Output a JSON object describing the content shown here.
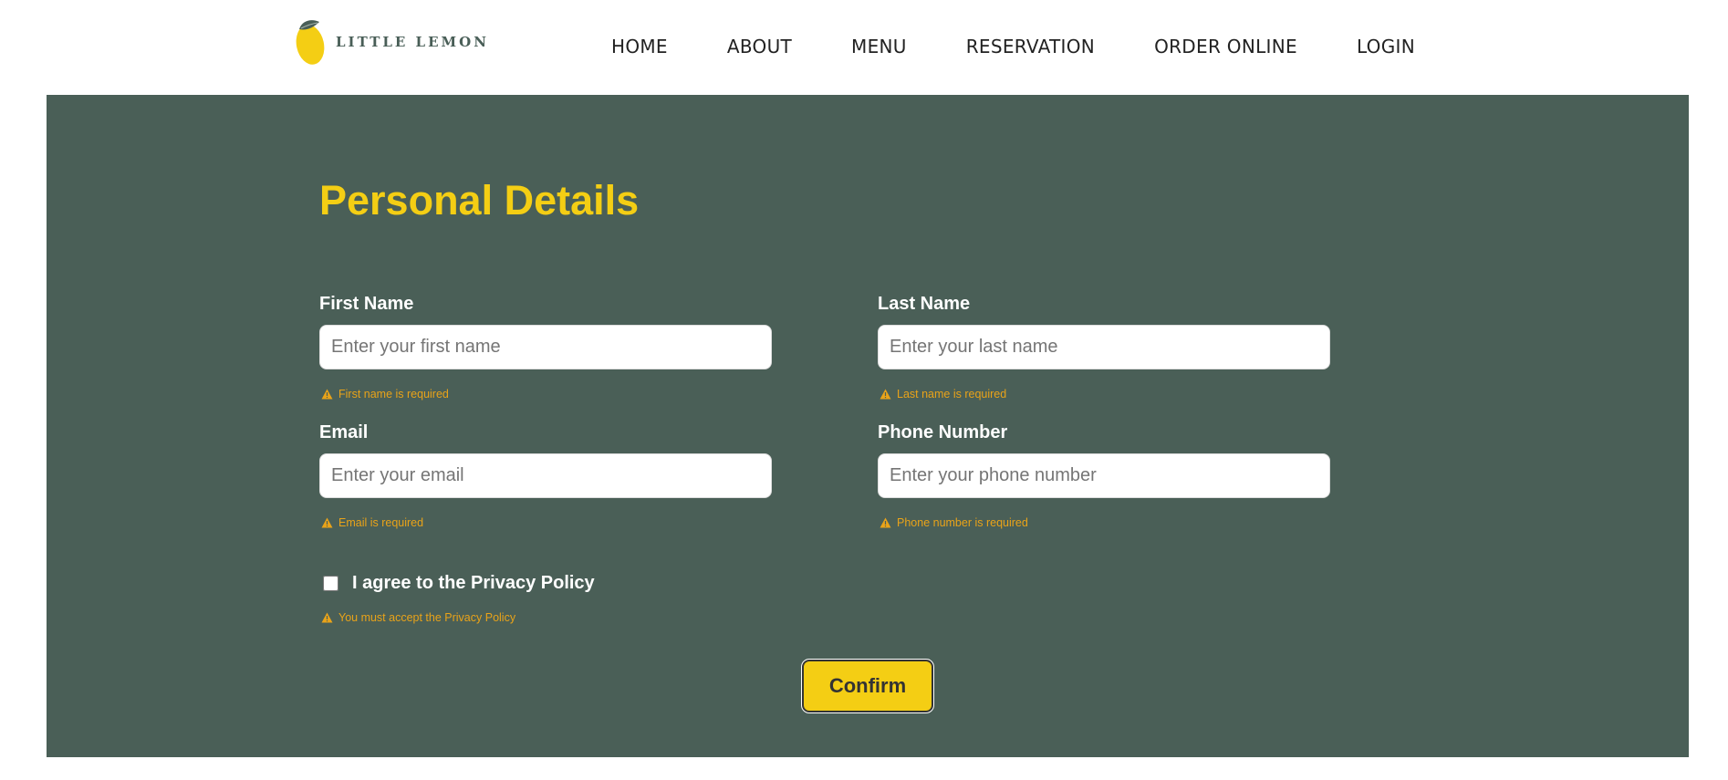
{
  "brand": {
    "name": "LITTLE LEMON",
    "logo_icon": "lemon-logo-icon",
    "colors": {
      "green": "#4a5f57",
      "yellow": "#f4ce14",
      "warning": "#e9a319"
    }
  },
  "nav": {
    "items": [
      {
        "label": "HOME"
      },
      {
        "label": "ABOUT"
      },
      {
        "label": "MENU"
      },
      {
        "label": "RESERVATION"
      },
      {
        "label": "ORDER ONLINE"
      },
      {
        "label": "LOGIN"
      }
    ]
  },
  "form": {
    "title": "Personal Details",
    "first_name": {
      "label": "First Name",
      "placeholder": "Enter your first name",
      "value": "",
      "error": "First name is required"
    },
    "last_name": {
      "label": "Last Name",
      "placeholder": "Enter your last name",
      "value": "",
      "error": "Last name is required"
    },
    "email": {
      "label": "Email",
      "placeholder": "Enter your email",
      "value": "",
      "error": "Email is required"
    },
    "phone": {
      "label": "Phone Number",
      "placeholder": "Enter your phone number",
      "value": "",
      "error": "Phone number is required"
    },
    "privacy": {
      "label": "I agree to the Privacy Policy",
      "checked": false,
      "error": "You must accept the Privacy Policy"
    },
    "confirm_label": "Confirm",
    "warning_icon": "warning-triangle-icon"
  }
}
